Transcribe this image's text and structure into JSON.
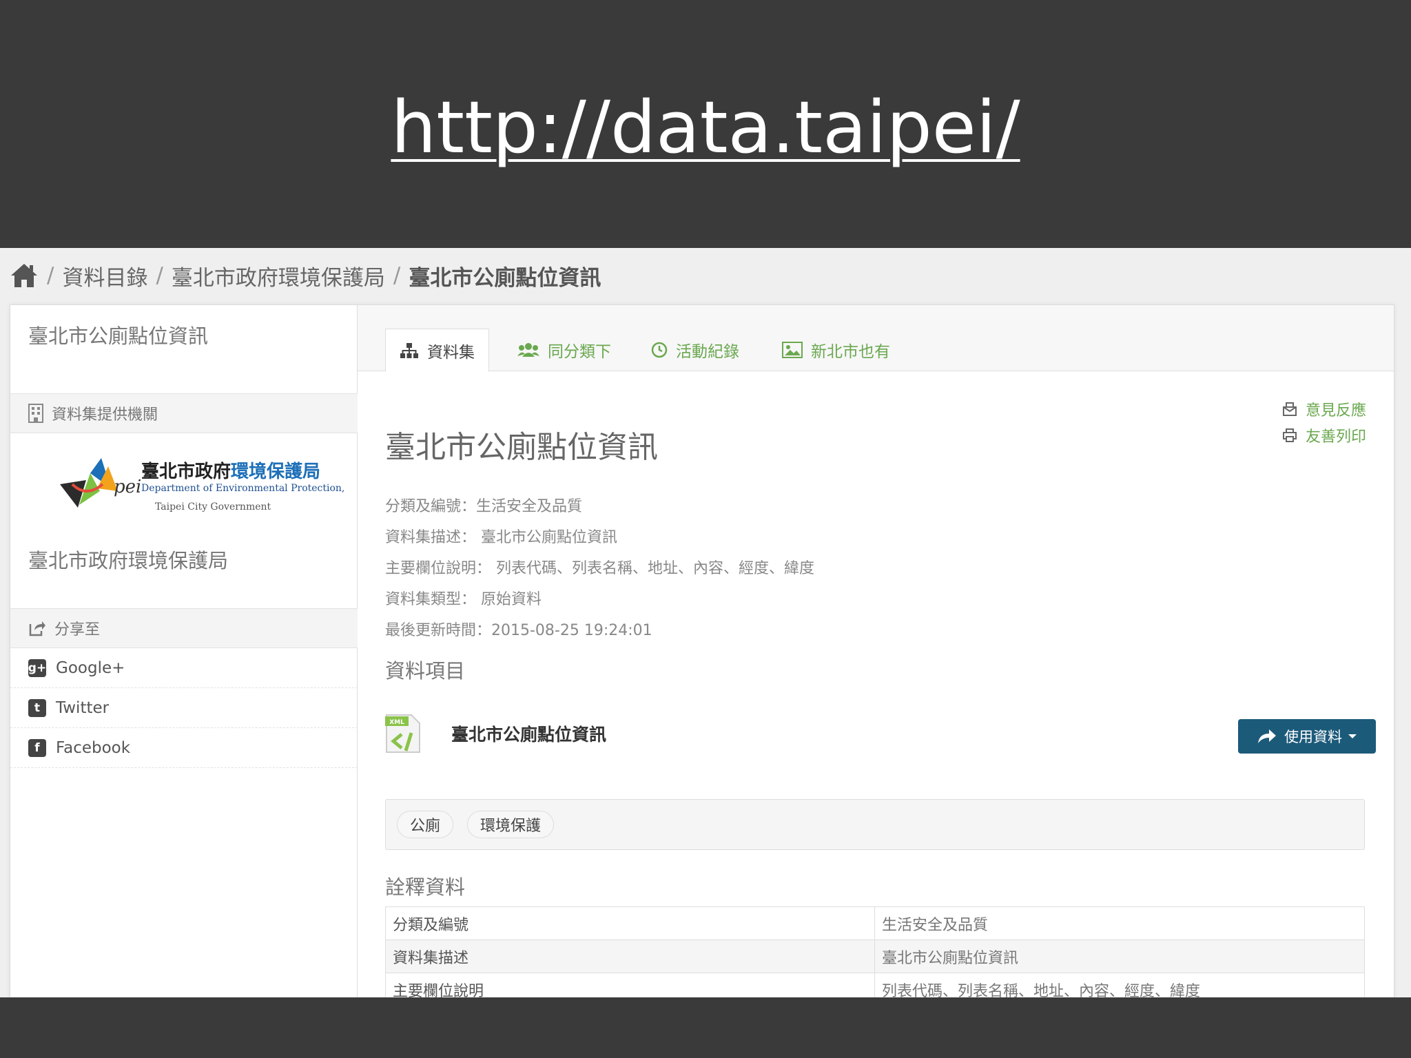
{
  "slide": {
    "title": "http://data.taipei/"
  },
  "breadcrumb": {
    "items": [
      "資料目錄",
      "臺北市政府環境保護局",
      "臺北市公廁點位資訊"
    ],
    "separator": "/"
  },
  "sidebar": {
    "title": "臺北市公廁點位資訊",
    "provider_header": "資料集提供機關",
    "logo": {
      "chinese_primary": "臺北市政府",
      "chinese_accent": "環境保護局",
      "english_line1": "Department of Environmental Protection,",
      "english_line2": "Taipei City Government"
    },
    "org_name": "臺北市政府環境保護局",
    "share_header": "分享至",
    "share_items": [
      {
        "label": "Google+",
        "glyph": "g+"
      },
      {
        "label": "Twitter",
        "glyph": "t"
      },
      {
        "label": "Facebook",
        "glyph": "f"
      }
    ]
  },
  "tabs": [
    {
      "label": "資料集",
      "icon": "sitemap-icon"
    },
    {
      "label": "同分類下",
      "icon": "users-icon"
    },
    {
      "label": "活動紀錄",
      "icon": "clock-icon"
    },
    {
      "label": "新北市也有",
      "icon": "image-icon"
    }
  ],
  "links": {
    "feedback": "意見反應",
    "print": "友善列印"
  },
  "dataset": {
    "title": "臺北市公廁點位資訊",
    "meta": [
      "分類及編號：生活安全及品質",
      "資料集描述： 臺北市公廁點位資訊",
      "主要欄位說明： 列表代碼、列表名稱、地址、內容、經度、緯度",
      "資料集類型： 原始資料",
      "最後更新時間：2015-08-25 19:24:01"
    ],
    "items_label": "資料項目",
    "resource": {
      "format": "XML",
      "name": "臺北市公廁點位資訊"
    },
    "use_button": "使用資料",
    "tags": [
      "公廁",
      "環境保護"
    ],
    "metadata_label": "詮釋資料",
    "metadata_rows": [
      {
        "key": "分類及編號",
        "value": "生活安全及品質"
      },
      {
        "key": "資料集描述",
        "value": "臺北市公廁點位資訊"
      },
      {
        "key": "主要欄位說明",
        "value": "列表代碼、列表名稱、地址、內容、經度、緯度"
      }
    ]
  },
  "colors": {
    "accent_green": "#6aa84f",
    "button_blue": "#1c5a7a",
    "slide_bg": "#3a3a3a"
  }
}
